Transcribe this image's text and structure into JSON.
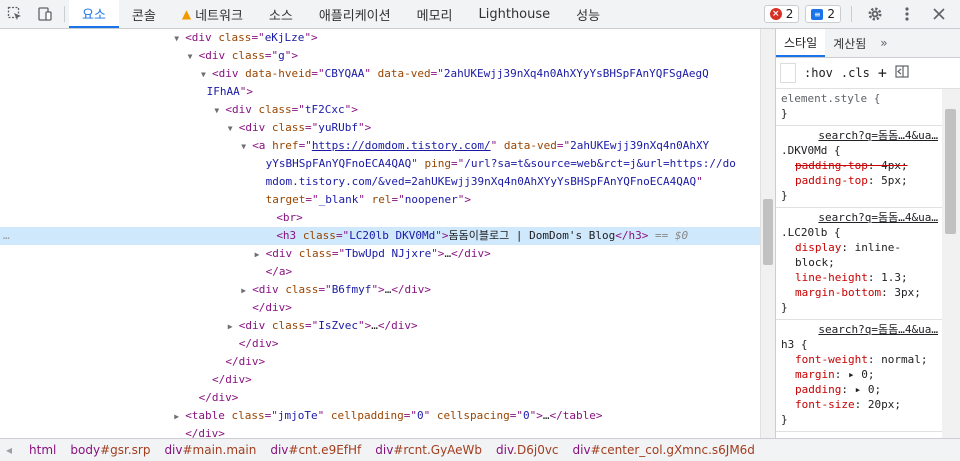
{
  "toolbar": {
    "tabs": [
      "요소",
      "콘솔",
      "네트워크",
      "소스",
      "애플리케이션",
      "메모리",
      "Lighthouse",
      "성능"
    ],
    "errors": "2",
    "messages": "2"
  },
  "dom_lines": [
    {
      "indent": 13,
      "tri": "▼",
      "html": [
        [
          "tag",
          "<div "
        ],
        [
          "an",
          "class"
        ],
        [
          "tag",
          "=\""
        ],
        [
          "av",
          "eKjLze"
        ],
        [
          "tag",
          "\">"
        ]
      ]
    },
    {
      "indent": 14,
      "tri": "▼",
      "html": [
        [
          "tag",
          "<div "
        ],
        [
          "an",
          "class"
        ],
        [
          "tag",
          "=\""
        ],
        [
          "av",
          "g"
        ],
        [
          "tag",
          "\">"
        ]
      ]
    },
    {
      "indent": 15,
      "tri": "▼",
      "html": [
        [
          "tag",
          "<div "
        ],
        [
          "an",
          "data-hveid"
        ],
        [
          "tag",
          "=\""
        ],
        [
          "av",
          "CBYQAA"
        ],
        [
          "tag",
          "\" "
        ],
        [
          "an",
          "data-ved"
        ],
        [
          "tag",
          "=\""
        ],
        [
          "av",
          "2ahUKEwjj39nXq4n0AhXYyYsBHSpFAnYQFSgAegQ"
        ]
      ]
    },
    {
      "indent": 14.6,
      "tri": "",
      "html": [
        [
          "av",
          "IFhAA"
        ],
        [
          "tag",
          "\">"
        ]
      ]
    },
    {
      "indent": 16,
      "tri": "▼",
      "html": [
        [
          "tag",
          "<div "
        ],
        [
          "an",
          "class"
        ],
        [
          "tag",
          "=\""
        ],
        [
          "av",
          "tF2Cxc"
        ],
        [
          "tag",
          "\">"
        ]
      ]
    },
    {
      "indent": 17,
      "tri": "▼",
      "html": [
        [
          "tag",
          "<div "
        ],
        [
          "an",
          "class"
        ],
        [
          "tag",
          "=\""
        ],
        [
          "av",
          "yuRUbf"
        ],
        [
          "tag",
          "\">"
        ]
      ]
    },
    {
      "indent": 18,
      "tri": "▼",
      "html": [
        [
          "tag",
          "<a "
        ],
        [
          "an",
          "href"
        ],
        [
          "tag",
          "=\""
        ],
        [
          "link",
          "https://domdom.tistory.com/"
        ],
        [
          "tag",
          "\" "
        ],
        [
          "an",
          "data-ved"
        ],
        [
          "tag",
          "=\""
        ],
        [
          "av",
          "2ahUKEwjj39nXq4n0AhXY"
        ]
      ]
    },
    {
      "indent": 19,
      "tri": "",
      "html": [
        [
          "av",
          "yYsBHSpFAnYQFnoECA4QAQ"
        ],
        [
          "tag",
          "\" "
        ],
        [
          "an",
          "ping"
        ],
        [
          "tag",
          "=\""
        ],
        [
          "av",
          "/url?sa=t&source=web&rct=j&url=https://do"
        ]
      ]
    },
    {
      "indent": 19,
      "tri": "",
      "html": [
        [
          "av",
          "mdom.tistory.com/&ved=2ahUKEwjj39nXq4n0AhXYyYsBHSpFAnYQFnoECA4QAQ"
        ],
        [
          "tag",
          "\""
        ]
      ]
    },
    {
      "indent": 19,
      "tri": "",
      "html": [
        [
          "an",
          "target"
        ],
        [
          "tag",
          "=\""
        ],
        [
          "av",
          "_blank"
        ],
        [
          "tag",
          "\" "
        ],
        [
          "an",
          "rel"
        ],
        [
          "tag",
          "=\""
        ],
        [
          "av",
          "noopener"
        ],
        [
          "tag",
          "\">"
        ]
      ]
    },
    {
      "indent": 19.8,
      "tri": "",
      "html": [
        [
          "tag",
          "<br>"
        ]
      ]
    },
    {
      "indent": 19.8,
      "tri": "",
      "sel": true,
      "html": [
        [
          "tag",
          "<h3 "
        ],
        [
          "an",
          "class"
        ],
        [
          "tag",
          "=\""
        ],
        [
          "av",
          "LC20lb DKV0Md"
        ],
        [
          "tag",
          "\">"
        ],
        [
          "txt",
          "돔돔이블로그 | DomDom's Blog"
        ],
        [
          "tag",
          "</h3>"
        ],
        [
          "dim",
          " == $0"
        ]
      ]
    },
    {
      "indent": 19,
      "tri": "▶",
      "html": [
        [
          "tag",
          "<div "
        ],
        [
          "an",
          "class"
        ],
        [
          "tag",
          "=\""
        ],
        [
          "av",
          "TbwUpd NJjxre"
        ],
        [
          "tag",
          "\">"
        ],
        [
          "txt",
          "…"
        ],
        [
          "tag",
          "</div>"
        ]
      ]
    },
    {
      "indent": 19,
      "tri": "",
      "html": [
        [
          "tag",
          "</a>"
        ]
      ]
    },
    {
      "indent": 18,
      "tri": "▶",
      "html": [
        [
          "tag",
          "<div "
        ],
        [
          "an",
          "class"
        ],
        [
          "tag",
          "=\""
        ],
        [
          "av",
          "B6fmyf"
        ],
        [
          "tag",
          "\">"
        ],
        [
          "txt",
          "…"
        ],
        [
          "tag",
          "</div>"
        ]
      ]
    },
    {
      "indent": 18,
      "tri": "",
      "html": [
        [
          "tag",
          "</div>"
        ]
      ]
    },
    {
      "indent": 17,
      "tri": "▶",
      "html": [
        [
          "tag",
          "<div "
        ],
        [
          "an",
          "class"
        ],
        [
          "tag",
          "=\""
        ],
        [
          "av",
          "IsZvec"
        ],
        [
          "tag",
          "\">"
        ],
        [
          "txt",
          "…"
        ],
        [
          "tag",
          "</div>"
        ]
      ]
    },
    {
      "indent": 17,
      "tri": "",
      "html": [
        [
          "tag",
          "</div>"
        ]
      ]
    },
    {
      "indent": 16,
      "tri": "",
      "html": [
        [
          "tag",
          "</div>"
        ]
      ]
    },
    {
      "indent": 15,
      "tri": "",
      "html": [
        [
          "tag",
          "</div>"
        ]
      ]
    },
    {
      "indent": 14,
      "tri": "",
      "html": [
        [
          "tag",
          "</div>"
        ]
      ]
    },
    {
      "indent": 13,
      "tri": "▶",
      "html": [
        [
          "tag",
          "<table "
        ],
        [
          "an",
          "class"
        ],
        [
          "tag",
          "=\""
        ],
        [
          "av",
          "jmjoTe"
        ],
        [
          "tag",
          "\" "
        ],
        [
          "an",
          "cellpadding"
        ],
        [
          "tag",
          "=\""
        ],
        [
          "av",
          "0"
        ],
        [
          "tag",
          "\" "
        ],
        [
          "an",
          "cellspacing"
        ],
        [
          "tag",
          "=\""
        ],
        [
          "av",
          "0"
        ],
        [
          "tag",
          "\">"
        ],
        [
          "txt",
          "…"
        ],
        [
          "tag",
          "</table>"
        ]
      ]
    },
    {
      "indent": 13,
      "tri": "",
      "html": [
        [
          "tag",
          "</div>"
        ]
      ]
    }
  ],
  "styles_pane": {
    "tabs": [
      "스타일",
      "계산됨"
    ],
    "hov": ":hov",
    "cls": ".cls",
    "element_style": "element.style {",
    "close": "}",
    "rules": [
      {
        "src": "search?q=돔돔…4&ua…",
        "selector": ".DKV0Md {",
        "props": [
          {
            "name": "padding-top",
            "value": "4px;",
            "strike": true
          },
          {
            "name": "padding-top",
            "value": "5px;",
            "strike": false
          }
        ]
      },
      {
        "src": "search?q=돔돔…4&ua…",
        "selector": ".LC20lb {",
        "props": [
          {
            "name": "display",
            "value": "inline-block;",
            "strike": false
          },
          {
            "name": "line-height",
            "value": "1.3;",
            "strike": false
          },
          {
            "name": "margin-bottom",
            "value": "3px;",
            "strike": false
          }
        ]
      },
      {
        "src": "search?q=돔돔…4&ua…",
        "selector": "h3 {",
        "props": [
          {
            "name": "font-weight",
            "value": "normal;",
            "strike": false
          },
          {
            "name": "margin",
            "value": "▸ 0;",
            "strike": false
          },
          {
            "name": "padding",
            "value": "▸ 0;",
            "strike": false
          },
          {
            "name": "font-size",
            "value": "20px;",
            "strike": false
          }
        ]
      }
    ]
  },
  "breadcrumbs": [
    {
      "tag": "html",
      "cls": ""
    },
    {
      "tag": "body",
      "cls": "#gsr.srp"
    },
    {
      "tag": "div",
      "cls": "#main.main"
    },
    {
      "tag": "div",
      "cls": "#cnt.e9EfHf"
    },
    {
      "tag": "div",
      "cls": "#rcnt.GyAeWb"
    },
    {
      "tag": "div",
      "cls": ".D6j0vc"
    },
    {
      "tag": "div",
      "cls": "#center_col.gXmnc.s6JM6d"
    }
  ]
}
